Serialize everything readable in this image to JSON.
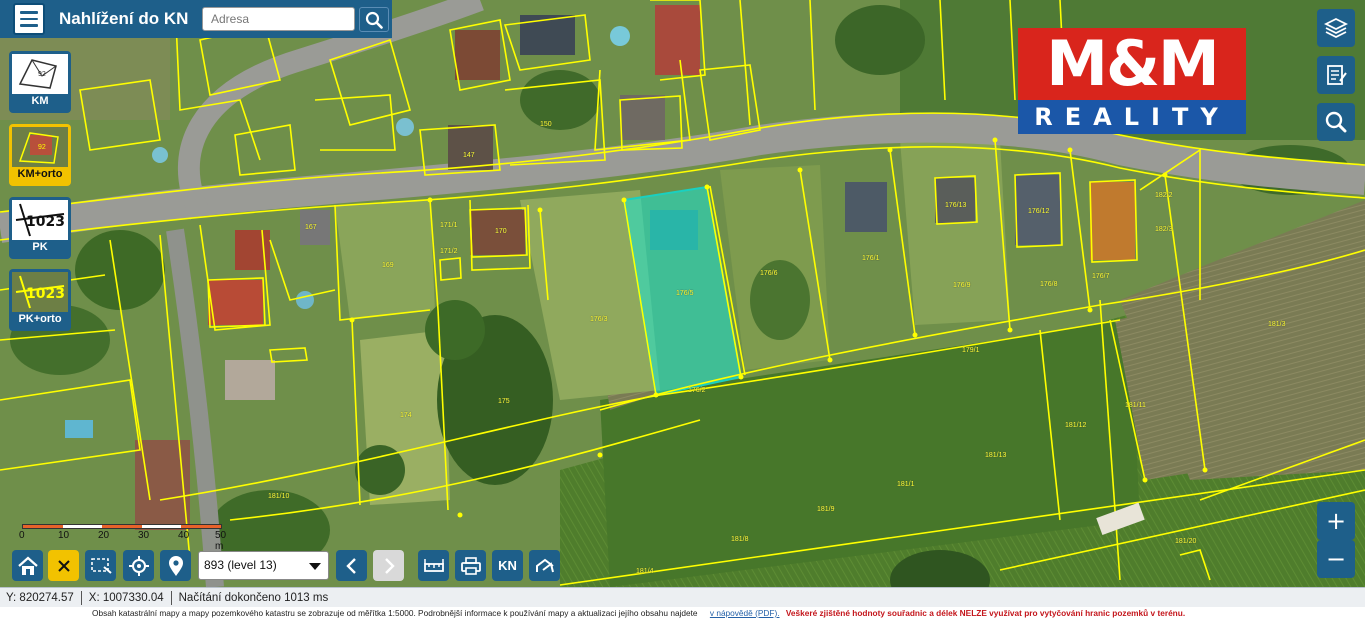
{
  "header": {
    "title": "Nahlížení do KN",
    "search_placeholder": "Adresa"
  },
  "layers": [
    {
      "label": "KM",
      "active": false
    },
    {
      "label": "KM+orto",
      "active": true
    },
    {
      "label": "PK",
      "active": false
    },
    {
      "label": "PK+orto",
      "active": false
    }
  ],
  "logo": {
    "top": "M&M",
    "bottom": "REALITY",
    "colors": {
      "red": "#d9251c",
      "blue": "#1b57a8"
    }
  },
  "scale": {
    "ticks": [
      "0",
      "10",
      "20",
      "30",
      "40",
      "50 m"
    ]
  },
  "toolbar": {
    "level_select": "893 (level 13)",
    "kn_label": "KN"
  },
  "status": {
    "y_coord": "Y: 820274.57",
    "x_coord": "X: 1007330.04",
    "loading": "Načítání dokončeno 1013 ms"
  },
  "footer": {
    "info": "Obsah katastrální mapy a mapy pozemkového katastru se zobrazuje od měřítka 1:5000. Podrobnější informace k používání mapy a aktualizaci jejího obsahu najdete",
    "link": "v nápovědě (PDF).",
    "warning": "Veškeré zjištěné hodnoty souřadnic a délek NELZE využívat pro vytyčování hranic pozemků v terénu."
  },
  "parcels": [
    "169",
    "170",
    "171/1",
    "171/2",
    "167",
    "174",
    "175",
    "176/1",
    "176/2",
    "176/3",
    "176/5",
    "176/6",
    "176/7",
    "176/8",
    "176/9",
    "176/12",
    "176/13",
    "179/1",
    "181/1",
    "181/3",
    "181/4",
    "181/8",
    "181/9",
    "181/11",
    "181/12",
    "181/13",
    "181/10",
    "181/20",
    "147",
    "150",
    "182/2",
    "182/3"
  ],
  "colors": {
    "accent": "#1e5f8a",
    "active_layer": "#f2c200",
    "parcel_line": "#ffff00",
    "highlight": "#19e6d4"
  }
}
